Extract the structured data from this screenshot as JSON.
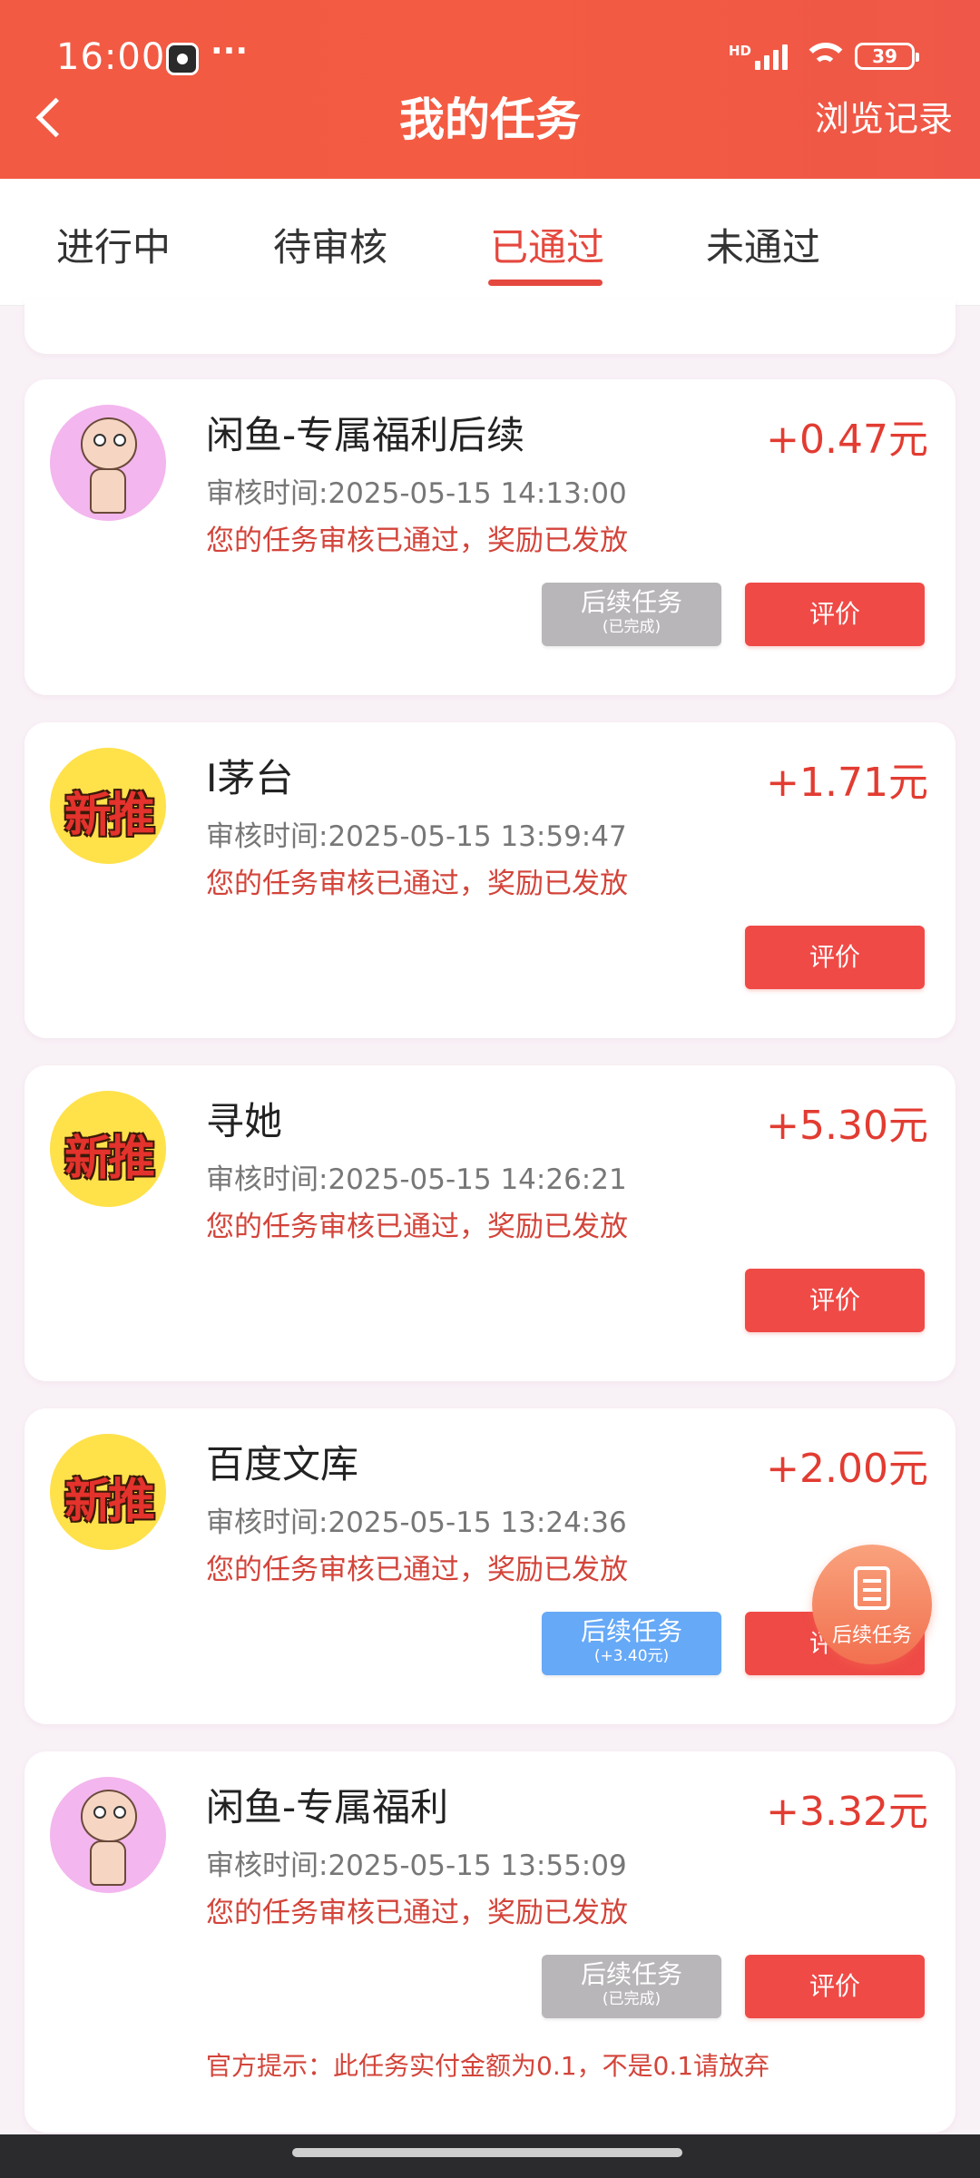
{
  "status_bar": {
    "time": "16:00",
    "dots": "···",
    "network": "HD",
    "battery": "39"
  },
  "nav": {
    "title": "我的任务",
    "history": "浏览记录"
  },
  "tabs": [
    "进行中",
    "待审核",
    "已通过",
    "未通过"
  ],
  "tasks": [
    {
      "avatar": "stewie-avatar",
      "title": "闲鱼-专属福利后续",
      "amount": "+0.47元",
      "time": "审核时间:2025-05-15 14:13:00",
      "status": "您的任务审核已通过，奖励已发放",
      "follow": {
        "line1": "后续任务",
        "line2": "(已完成)"
      },
      "review": "评价"
    },
    {
      "avatar": "new-badge",
      "badge_text": "新推",
      "title": "I茅台",
      "amount": "+1.71元",
      "time": "审核时间:2025-05-15 13:59:47",
      "status": "您的任务审核已通过，奖励已发放",
      "review": "评价"
    },
    {
      "avatar": "new-badge",
      "badge_text": "新推",
      "title": "寻她",
      "amount": "+5.30元",
      "time": "审核时间:2025-05-15 14:26:21",
      "status": "您的任务审核已通过，奖励已发放",
      "review": "评价"
    },
    {
      "avatar": "new-badge",
      "badge_text": "新推",
      "title": "百度文库",
      "amount": "+2.00元",
      "time": "审核时间:2025-05-15 13:24:36",
      "status": "您的任务审核已通过，奖励已发放",
      "follow": {
        "line1": "后续任务",
        "line2": "(+3.40元)"
      },
      "review": "评价"
    },
    {
      "avatar": "stewie-avatar",
      "title": "闲鱼-专属福利",
      "amount": "+3.32元",
      "time": "审核时间:2025-05-15 13:55:09",
      "status": "您的任务审核已通过，奖励已发放",
      "follow": {
        "line1": "后续任务",
        "line2": "(已完成)"
      },
      "review": "评价",
      "note": "官方提示：此任务实付金额为0.1，不是0.1请放弃"
    }
  ],
  "float_button": {
    "label": "后续任务"
  },
  "colors": {
    "brand": "#f25a43",
    "accent_red": "#e23c32",
    "follow_done": "#b9b6b9",
    "follow_active": "#66a9f7"
  }
}
